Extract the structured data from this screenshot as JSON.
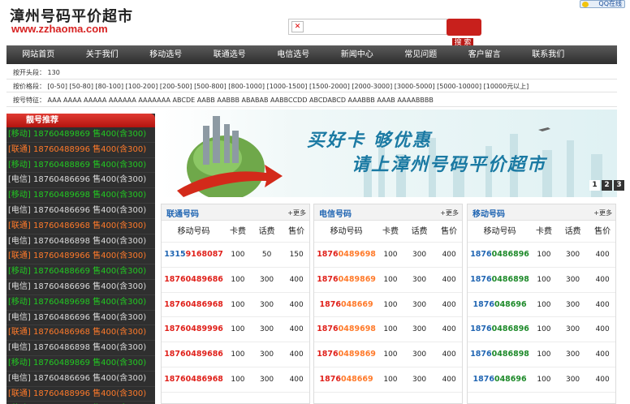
{
  "header": {
    "title": "漳州号码平价超市",
    "url": "www.zzhaoma.com",
    "qq_label": "QQ在线",
    "search_button": "搜 索"
  },
  "nav": [
    "网站首页",
    "关于我们",
    "移动选号",
    "联通选号",
    "电信选号",
    "新闻中心",
    "常见问题",
    "客户留言",
    "联系我们"
  ],
  "filters": {
    "head": {
      "label": "按开头段：",
      "value": "130"
    },
    "price": {
      "label": "按价格段：",
      "value": "[0-50] [50-80] [80-100] [100-200] [200-500] [500-800] [800-1000] [1000-1500] [1500-2000] [2000-3000] [3000-5000] [5000-10000] [10000元以上]"
    },
    "feature": {
      "label": "按号特征：",
      "value": "AAA AAAA AAAAA AAAAAA AAAAAAA ABCDE AABB AABBB ABABAB AABBCCDD ABCDABCD AAABBB AAAB AAAABBBB"
    }
  },
  "sidebar": {
    "title": "靓号推荐",
    "colors": {
      "移动": "#22c922",
      "联通": "#ff7a2a",
      "电信": "#dcdcdc"
    },
    "items": [
      {
        "carrier": "移动",
        "text": "[移动] 18760489869 售400(含300)"
      },
      {
        "carrier": "联通",
        "text": "[联通] 18760488996 售400(含300)"
      },
      {
        "carrier": "移动",
        "text": "[移动] 18760488869 售400(含300)"
      },
      {
        "carrier": "电信",
        "text": "[电信] 18760486696 售400(含300)"
      },
      {
        "carrier": "移动",
        "text": "[移动] 18760489698 售400(含300)"
      },
      {
        "carrier": "电信",
        "text": "[电信] 18760486696 售400(含300)"
      },
      {
        "carrier": "联通",
        "text": "[联通] 18760486968 售400(含300)"
      },
      {
        "carrier": "电信",
        "text": "[电信] 18760486898 售400(含300)"
      },
      {
        "carrier": "联通",
        "text": "[联通] 18760489966 售400(含300)"
      },
      {
        "carrier": "移动",
        "text": "[移动] 18760488669 售400(含300)"
      },
      {
        "carrier": "电信",
        "text": "[电信] 18760486696 售400(含300)"
      },
      {
        "carrier": "移动",
        "text": "[移动] 18760489698 售400(含300)"
      },
      {
        "carrier": "电信",
        "text": "[电信] 18760486696 售400(含300)"
      },
      {
        "carrier": "联通",
        "text": "[联通] 18760486968 售400(含300)"
      },
      {
        "carrier": "电信",
        "text": "[电信] 18760486898 售400(含300)"
      },
      {
        "carrier": "移动",
        "text": "[移动] 18760489869 售400(含300)"
      },
      {
        "carrier": "电信",
        "text": "[电信] 18760486696 售400(含300)"
      },
      {
        "carrier": "联通",
        "text": "[联通] 18760488996 售400(含300)"
      },
      {
        "carrier": "移动",
        "text": "[移动] 18760488869 售400(含300)"
      }
    ]
  },
  "banner": {
    "line1": "买好卡 够优惠",
    "line2": "请上漳州号码平价超市",
    "pages": [
      "1",
      "2",
      "3"
    ]
  },
  "panels": [
    {
      "title": "联通号码",
      "more": "+更多",
      "columns": [
        "移动号码",
        "卡费",
        "话费",
        "售价"
      ],
      "rows": [
        {
          "num_a": "1315",
          "num_b": "9168087",
          "c_a": "#2166b3",
          "c_b": "#e0211b",
          "fee": "100",
          "credit": "50",
          "price": "150"
        },
        {
          "num_a": "1876",
          "num_b": "0489686",
          "c_a": "#e0211b",
          "c_b": "#e0211b",
          "fee": "100",
          "credit": "300",
          "price": "400"
        },
        {
          "num_a": "1876",
          "num_b": "0486968",
          "c_a": "#e0211b",
          "c_b": "#e0211b",
          "fee": "100",
          "credit": "300",
          "price": "400"
        },
        {
          "num_a": "1876",
          "num_b": "0489996",
          "c_a": "#e0211b",
          "c_b": "#e0211b",
          "fee": "100",
          "credit": "300",
          "price": "400"
        },
        {
          "num_a": "1876",
          "num_b": "0489686",
          "c_a": "#e0211b",
          "c_b": "#e0211b",
          "fee": "100",
          "credit": "300",
          "price": "400"
        },
        {
          "num_a": "1876",
          "num_b": "0486968",
          "c_a": "#e0211b",
          "c_b": "#e0211b",
          "fee": "100",
          "credit": "300",
          "price": "400"
        }
      ]
    },
    {
      "title": "电信号码",
      "more": "+更多",
      "columns": [
        "移动号码",
        "卡费",
        "话费",
        "售价"
      ],
      "rows": [
        {
          "num_a": "1876",
          "num_b": "0489698",
          "c_a": "#e0211b",
          "c_b": "#ff7a2a",
          "fee": "100",
          "credit": "300",
          "price": "400"
        },
        {
          "num_a": "1876",
          "num_b": "0489869",
          "c_a": "#e0211b",
          "c_b": "#ff7a2a",
          "fee": "100",
          "credit": "300",
          "price": "400"
        },
        {
          "num_a": "1876",
          "num_b": "048669",
          "c_a": "#e0211b",
          "c_b": "#ff7a2a",
          "fee": "100",
          "credit": "300",
          "price": "400"
        },
        {
          "num_a": "1876",
          "num_b": "0489698",
          "c_a": "#e0211b",
          "c_b": "#ff7a2a",
          "fee": "100",
          "credit": "300",
          "price": "400"
        },
        {
          "num_a": "1876",
          "num_b": "0489869",
          "c_a": "#e0211b",
          "c_b": "#ff7a2a",
          "fee": "100",
          "credit": "300",
          "price": "400"
        },
        {
          "num_a": "1876",
          "num_b": "048669",
          "c_a": "#e0211b",
          "c_b": "#ff7a2a",
          "fee": "100",
          "credit": "300",
          "price": "400"
        }
      ]
    },
    {
      "title": "移动号码",
      "more": "+更多",
      "columns": [
        "移动号码",
        "卡费",
        "话费",
        "售价"
      ],
      "rows": [
        {
          "num_a": "1876",
          "num_b": "0486896",
          "c_a": "#2166b3",
          "c_b": "#1e8a2a",
          "fee": "100",
          "credit": "300",
          "price": "400"
        },
        {
          "num_a": "1876",
          "num_b": "0486898",
          "c_a": "#2166b3",
          "c_b": "#1e8a2a",
          "fee": "100",
          "credit": "300",
          "price": "400"
        },
        {
          "num_a": "1876",
          "num_b": "048696",
          "c_a": "#2166b3",
          "c_b": "#1e8a2a",
          "fee": "100",
          "credit": "300",
          "price": "400"
        },
        {
          "num_a": "1876",
          "num_b": "0486896",
          "c_a": "#2166b3",
          "c_b": "#1e8a2a",
          "fee": "100",
          "credit": "300",
          "price": "400"
        },
        {
          "num_a": "1876",
          "num_b": "0486898",
          "c_a": "#2166b3",
          "c_b": "#1e8a2a",
          "fee": "100",
          "credit": "300",
          "price": "400"
        },
        {
          "num_a": "1876",
          "num_b": "048696",
          "c_a": "#2166b3",
          "c_b": "#1e8a2a",
          "fee": "100",
          "credit": "300",
          "price": "400"
        }
      ]
    }
  ]
}
